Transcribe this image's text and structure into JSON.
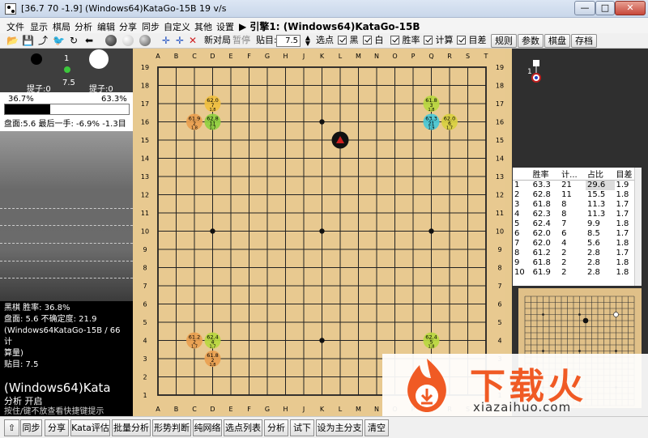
{
  "window": {
    "title": "[36.7 70 -1.9] (Windows64)KataGo-15B 19 v/s",
    "min_label": "—",
    "max_label": "□",
    "close_label": "✕"
  },
  "menu": {
    "items": [
      "文件",
      "显示",
      "棋局",
      "分析",
      "编辑",
      "分享",
      "同步",
      "自定义",
      "其他",
      "设置"
    ],
    "engine": "▶ 引擎1: (Windows64)KataGo-15B"
  },
  "toolbar": {
    "new_game": "新对局",
    "pause": "暂停",
    "komi_label": "贴目:",
    "komi_value": "7.5",
    "choose_point": "选点",
    "black": "黑",
    "white": "白",
    "winrate": "胜率",
    "calc": "计算",
    "target": "目差",
    "rules": "规则",
    "params": "参数",
    "board": "棋盘",
    "save": "存档"
  },
  "players": {
    "move_number": "1",
    "black_captures": "提子:0",
    "white_captures": "提子:0",
    "komi": "7.5",
    "black_rate": "36.7%",
    "white_rate": "63.3%",
    "black_fraction": 0.367,
    "summary": "盘面:5.6 最后一手: -6.9% -1.3目"
  },
  "analysis": {
    "lines": [
      "黑棋 胜率: 36.8%",
      "盘面: 5.6 不确定度: 21.9",
      "(Windows64KataGo-15B / 66 计",
      "算量)",
      "贴目: 7.5"
    ],
    "engine": "(Windows64)Kata",
    "status": "分析 开启",
    "hint": "按住/键不放查看快捷键提示"
  },
  "board": {
    "columns": [
      "A",
      "B",
      "C",
      "D",
      "E",
      "F",
      "G",
      "H",
      "J",
      "K",
      "L",
      "M",
      "N",
      "O",
      "P",
      "Q",
      "R",
      "S",
      "T"
    ],
    "rows": [
      "19",
      "18",
      "17",
      "16",
      "15",
      "14",
      "13",
      "12",
      "11",
      "10",
      "9",
      "8",
      "7",
      "6",
      "5",
      "4",
      "3",
      "2",
      "1"
    ],
    "stone": {
      "col": "L",
      "row": "15",
      "color": "black",
      "marker": "red-triangle"
    },
    "hoshi": [
      "D16",
      "K16",
      "Q16",
      "D10",
      "K10",
      "Q10",
      "D4",
      "K4",
      "Q4"
    ],
    "candidates": [
      {
        "col": "D",
        "row": "17",
        "rate": "62.0",
        "visits": "7",
        "score": "1.8",
        "color": "#f0c040"
      },
      {
        "col": "D",
        "row": "16",
        "rate": "62.8",
        "visits": "11",
        "score": "1.7",
        "color": "#8fd040"
      },
      {
        "col": "C",
        "row": "16",
        "rate": "61.9",
        "visits": "2",
        "score": "1.8",
        "color": "#e9a050"
      },
      {
        "col": "Q",
        "row": "17",
        "rate": "61.8",
        "visits": "3",
        "score": "1.8",
        "color": "#b8d840"
      },
      {
        "col": "Q",
        "row": "16",
        "rate": "63.3",
        "visits": "21",
        "score": "1.9",
        "color": "#48c8d8"
      },
      {
        "col": "R",
        "row": "16",
        "rate": "62.0",
        "visits": "6",
        "score": "1.7",
        "color": "#d8d040"
      },
      {
        "col": "C",
        "row": "4",
        "rate": "61.2",
        "visits": "2",
        "score": "1.7",
        "color": "#e9a050"
      },
      {
        "col": "D",
        "row": "4",
        "rate": "62.4",
        "visits": "4",
        "score": "1.7",
        "color": "#b8d840"
      },
      {
        "col": "D",
        "row": "3",
        "rate": "61.8",
        "visits": "2",
        "score": "1.8",
        "color": "#e9a050"
      },
      {
        "col": "Q",
        "row": "4",
        "rate": "62.4",
        "visits": "5",
        "score": "1.8",
        "color": "#b8d840"
      }
    ]
  },
  "table": {
    "headers": [
      "",
      "胜率",
      "计...",
      "占比",
      "目差"
    ],
    "rows": [
      [
        "1",
        "63.3",
        "21",
        "29.6",
        "1.9"
      ],
      [
        "2",
        "62.8",
        "11",
        "15.5",
        "1.8"
      ],
      [
        "3",
        "61.8",
        "8",
        "11.3",
        "1.7"
      ],
      [
        "4",
        "62.3",
        "8",
        "11.3",
        "1.7"
      ],
      [
        "5",
        "62.4",
        "7",
        "9.9",
        "1.8"
      ],
      [
        "6",
        "62.0",
        "6",
        "8.5",
        "1.7"
      ],
      [
        "7",
        "62.0",
        "4",
        "5.6",
        "1.8"
      ],
      [
        "8",
        "61.2",
        "2",
        "2.8",
        "1.7"
      ],
      [
        "9",
        "61.8",
        "2",
        "2.8",
        "1.8"
      ],
      [
        "10",
        "61.9",
        "2",
        "2.8",
        "1.8"
      ]
    ]
  },
  "mini_move_number": "1",
  "bottom": {
    "buttons": [
      "同步",
      "分享",
      "Kata评估",
      "批量分析",
      "形势判断",
      "纯网络",
      "选点列表",
      "分析",
      "试下",
      "设为主分支",
      "清空"
    ]
  },
  "watermark": {
    "text": "下载火",
    "url": "xiazaihuo.com"
  }
}
